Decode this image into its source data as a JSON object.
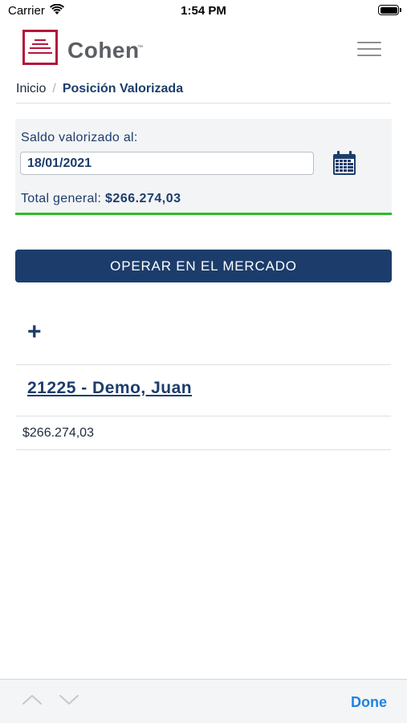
{
  "status_bar": {
    "carrier": "Carrier",
    "time": "1:54 PM"
  },
  "header": {
    "logo_text": "Cohen",
    "logo_tm": "™",
    "brand_color": "#b3173a",
    "menu_icon": "hamburger-menu-icon"
  },
  "breadcrumb": {
    "home": "Inicio",
    "separator": "/",
    "current": "Posición Valorizada"
  },
  "saldo": {
    "label": "Saldo valorizado al:",
    "date_value": "18/01/2021",
    "calendar_icon": "calendar-icon",
    "total_label": "Total general:",
    "total_value": "$266.274,03",
    "status_color": "#2ebd2a"
  },
  "actions": {
    "operar_label": "OPERAR EN EL MERCADO",
    "primary_color": "#1c3d6b",
    "expand_symbol": "+"
  },
  "accounts": [
    {
      "title": "21225 - Demo, Juan",
      "amount": "$266.274,03"
    }
  ],
  "toolbar": {
    "up_icon": "chevron-up-icon",
    "down_icon": "chevron-down-icon",
    "done_label": "Done",
    "done_color": "#1e84e0"
  }
}
